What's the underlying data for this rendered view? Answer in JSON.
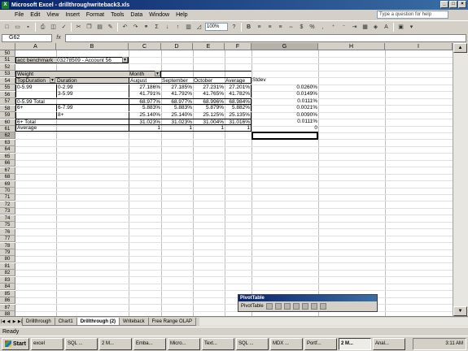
{
  "window": {
    "title": "Microsoft Excel - drillthroughwriteback3.xls"
  },
  "menu": [
    "File",
    "Edit",
    "View",
    "Insert",
    "Format",
    "Tools",
    "Data",
    "Window",
    "Help"
  ],
  "help_placeholder": "Type a question for help",
  "toolbar": {
    "zoom": "100%"
  },
  "formula_bar": {
    "name_box": "G62",
    "fx": "fx",
    "value": ""
  },
  "columns": [
    "A",
    "B",
    "C",
    "D",
    "E",
    "F",
    "G",
    "H",
    "I"
  ],
  "rows": [
    "50",
    "51",
    "52",
    "53",
    "54",
    "55",
    "56",
    "57",
    "58",
    "59",
    "60",
    "61",
    "62",
    "63",
    "64",
    "65",
    "66",
    "67",
    "68",
    "69",
    "70",
    "71",
    "72",
    "73",
    "74",
    "75",
    "76",
    "77",
    "78",
    "79",
    "80",
    "81",
    "82",
    "83",
    "84",
    "85",
    "86",
    "87",
    "88"
  ],
  "cells": {
    "a51": "acc benchmark",
    "b51": "03278509 - Account 56",
    "a53": "Weight",
    "c53": "Month",
    "a54": "TopDuration",
    "b54": "Duration",
    "c54": "August",
    "d54": "September",
    "e54": "October",
    "f54": "Average",
    "g54": "Stdev",
    "a55": "0-5.99",
    "b55": "0-2.99",
    "c55": "27.186%",
    "d55": "27.185%",
    "e55": "27.231%",
    "f55": "27.201%",
    "g55": "0.0260%",
    "b56": "3-5.99",
    "c56": "41.791%",
    "d56": "41.792%",
    "e56": "41.765%",
    "f56": "41.782%",
    "g56": "0.0149%",
    "a57": "0-5.99 Total",
    "c57": "68.977%",
    "d57": "68.977%",
    "e57": "68.996%",
    "f57": "68.984%",
    "g57": "0.0111%",
    "a58": "6+",
    "b58": "6-7.99",
    "c58": "5.883%",
    "d58": "5.883%",
    "e58": "5.879%",
    "f58": "5.882%",
    "g58": "0.0021%",
    "b59": "8+",
    "c59": "25.140%",
    "d59": "25.140%",
    "e59": "25.125%",
    "f59": "25.135%",
    "g59": "0.0090%",
    "a60": "6+ Total",
    "c60": "31.023%",
    "d60": "31.023%",
    "e60": "31.004%",
    "f60": "31.016%",
    "g60": "0.0111%",
    "a61": "Average",
    "c61": "1",
    "d61": "1",
    "e61": "1",
    "f61": "1",
    "g61": "0"
  },
  "sheet_tabs": [
    "Drillthrough",
    "Chart1",
    "Drillthrough (2)",
    "Writeback",
    "Free Range OLAP"
  ],
  "active_tab": "Drillthrough (2)",
  "status": "Ready",
  "pivot_toolbar": {
    "title": "PivotTable",
    "menu_label": "PivotTable"
  },
  "taskbar": {
    "start": "Start",
    "items": [
      "excel",
      "SQL ...",
      "2 M...",
      "Emba...",
      "Micro...",
      "Text...",
      "SQL ...",
      "MDX ...",
      "Portf...",
      "2 M...",
      "Anal..."
    ],
    "active_index": 9,
    "clock": "3:11 AM"
  }
}
